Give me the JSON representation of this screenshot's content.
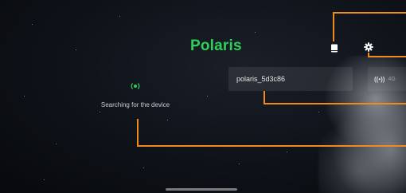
{
  "app": {
    "title": "Polaris"
  },
  "toolbar": {
    "book_icon": "book-icon",
    "settings_icon": "gear-icon"
  },
  "device": {
    "name": "polaris_5d3c86",
    "network": "4G",
    "signal_icon": "signal-antenna-icon"
  },
  "status": {
    "text": "Searching for the device",
    "icon": "searching-indicator-icon"
  },
  "colors": {
    "accent": "#2fcf5a",
    "callout": "#f08a1c",
    "background": "#0b0d12"
  }
}
